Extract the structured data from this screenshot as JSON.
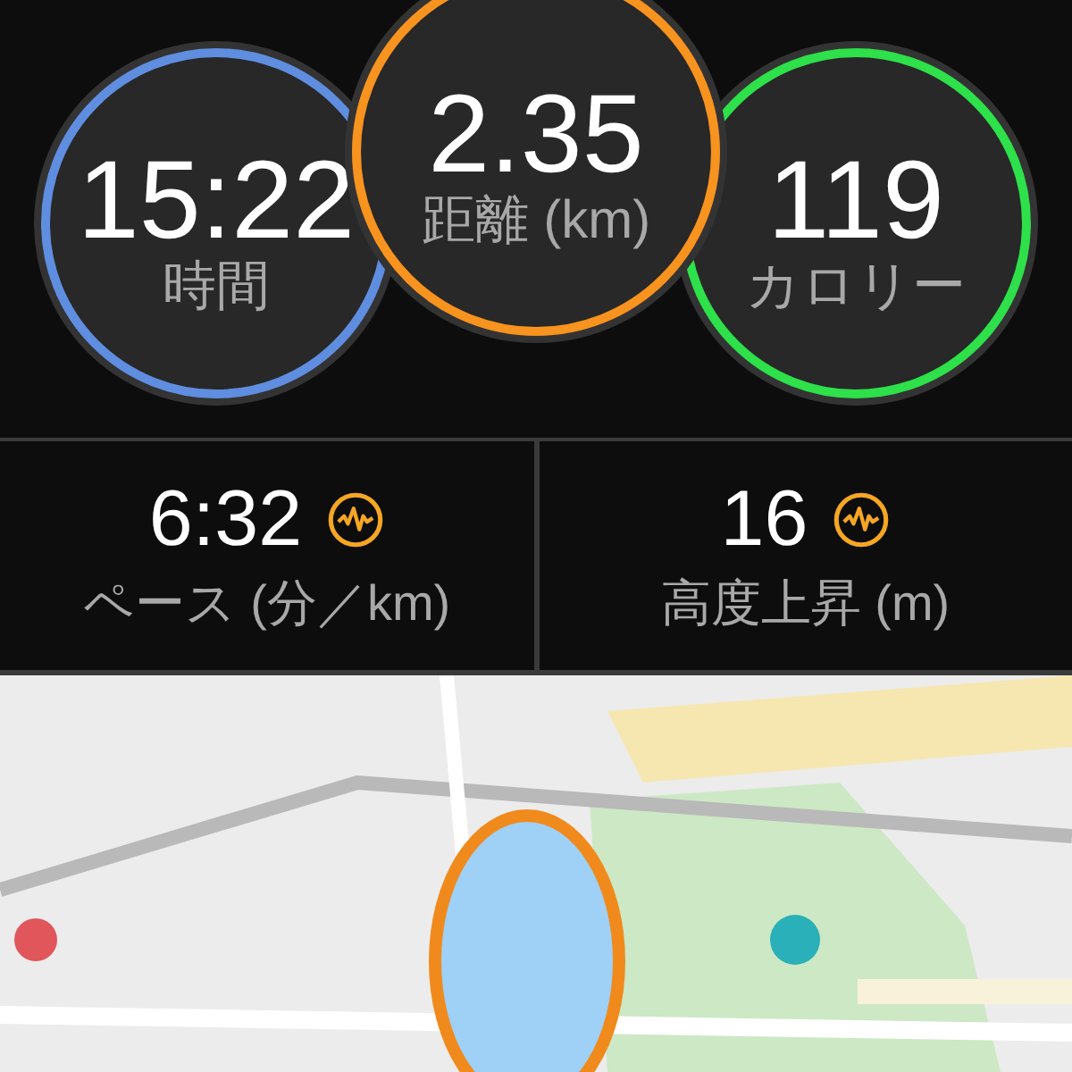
{
  "rings": [
    {
      "value": "15:22",
      "label": "時間",
      "color": "#5f8ee0"
    },
    {
      "value": "2.35",
      "label": "距離 (km)",
      "color": "#f7931e"
    },
    {
      "value": "119",
      "label": "カロリー",
      "color": "#2ee04a"
    }
  ],
  "stats": [
    {
      "value": "6:32",
      "label": "ペース (分／km)"
    },
    {
      "value": "16",
      "label": "高度上昇 (m)"
    }
  ]
}
